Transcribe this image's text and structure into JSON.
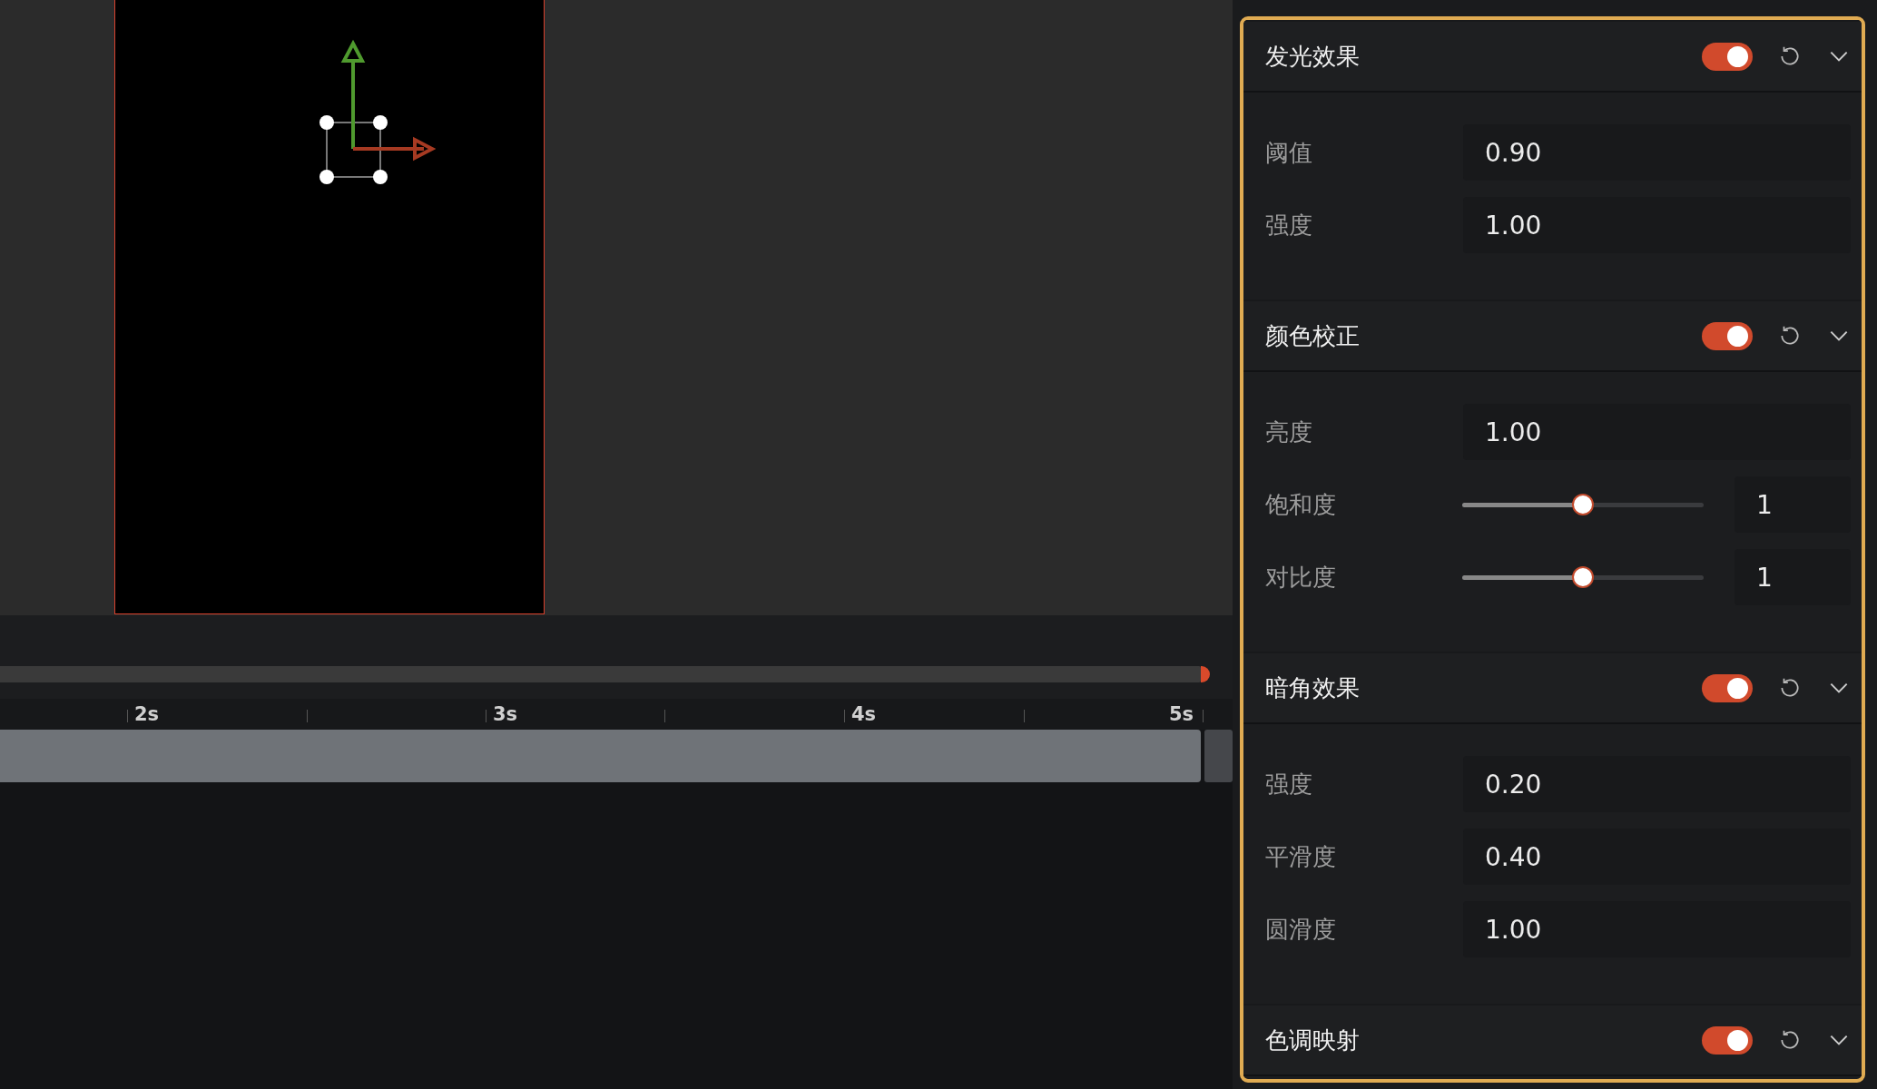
{
  "timeline": {
    "ruler_labels": [
      "2s",
      "3s",
      "4s",
      "5s"
    ]
  },
  "effects": [
    {
      "title": "发光效果",
      "on": true,
      "expanded": true,
      "fields": [
        {
          "kind": "number",
          "label": "阈值",
          "value": "0.90"
        },
        {
          "kind": "number",
          "label": "强度",
          "value": "1.00"
        }
      ]
    },
    {
      "title": "颜色校正",
      "on": true,
      "expanded": true,
      "fields": [
        {
          "kind": "number",
          "label": "亮度",
          "value": "1.00"
        },
        {
          "kind": "slider",
          "label": "饱和度",
          "level": 0.5,
          "value": "1"
        },
        {
          "kind": "slider",
          "label": "对比度",
          "level": 0.5,
          "value": "1"
        }
      ]
    },
    {
      "title": "暗角效果",
      "on": true,
      "expanded": true,
      "fields": [
        {
          "kind": "number",
          "label": "强度",
          "value": "0.20"
        },
        {
          "kind": "number",
          "label": "平滑度",
          "value": "0.40"
        },
        {
          "kind": "number",
          "label": "圆滑度",
          "value": "1.00"
        }
      ]
    },
    {
      "title": "色调映射",
      "on": true,
      "expanded": true
    }
  ]
}
